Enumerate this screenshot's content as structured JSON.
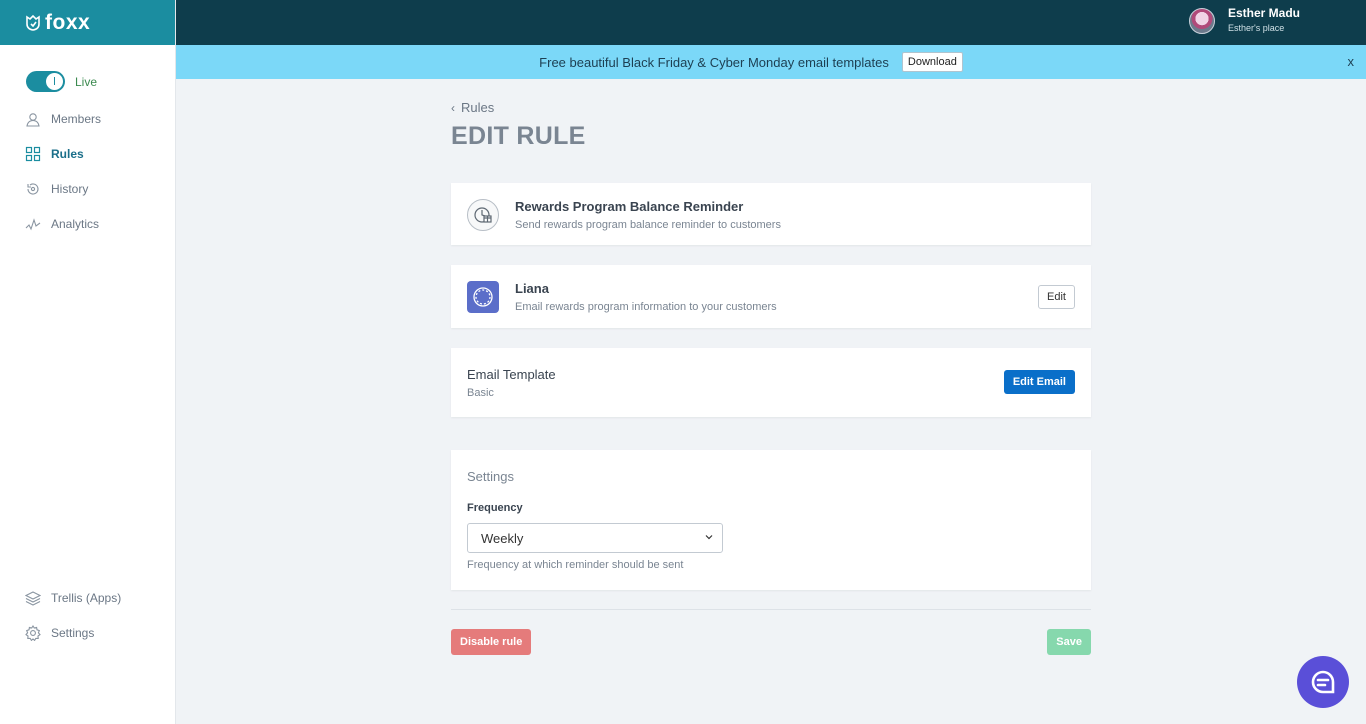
{
  "app": {
    "logo_text": "foxx"
  },
  "sidebar": {
    "live_label": "Live",
    "items": [
      {
        "label": "Members",
        "icon": "members-icon"
      },
      {
        "label": "Rules",
        "icon": "rules-icon",
        "active": true
      },
      {
        "label": "History",
        "icon": "history-icon"
      },
      {
        "label": "Analytics",
        "icon": "analytics-icon"
      }
    ],
    "bottom_items": [
      {
        "label": "Trellis (Apps)",
        "icon": "layers-icon"
      },
      {
        "label": "Settings",
        "icon": "gear-icon"
      }
    ]
  },
  "user": {
    "name": "Esther Madu",
    "place": "Esther's place"
  },
  "banner": {
    "text": "Free beautiful Black Friday & Cyber Monday email templates",
    "button": "Download",
    "close": "x"
  },
  "page": {
    "breadcrumb": "Rules",
    "title": "EDIT RULE"
  },
  "rule_card": {
    "title": "Rewards Program Balance Reminder",
    "subtitle": "Send rewards program balance reminder to customers"
  },
  "integration_card": {
    "title": "Liana",
    "subtitle": "Email rewards program information to your customers",
    "edit_label": "Edit"
  },
  "template_card": {
    "title": "Email Template",
    "subtitle": "Basic",
    "edit_email_label": "Edit Email"
  },
  "settings": {
    "title": "Settings",
    "frequency_label": "Frequency",
    "frequency_value": "Weekly",
    "frequency_help": "Frequency at which reminder should be sent"
  },
  "actions": {
    "disable_label": "Disable rule",
    "save_label": "Save"
  },
  "colors": {
    "brand": "#1b8da0",
    "topbar": "#0e3d4c",
    "banner": "#7bd8f8",
    "primary": "#0a6fc9",
    "danger": "#e57b7b",
    "success": "#86d8ad",
    "chat": "#5a4fd8"
  }
}
